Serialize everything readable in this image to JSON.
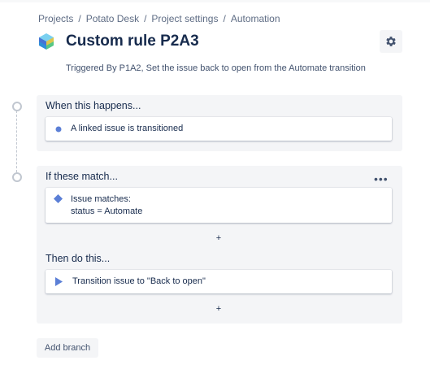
{
  "breadcrumb": {
    "items": [
      "Projects",
      "Potato Desk",
      "Project settings",
      "Automation"
    ],
    "separator": "/"
  },
  "rule": {
    "title": "Custom rule P2A3",
    "subtitle": "Triggered By P1A2, Set the issue back to open from the Automate transition"
  },
  "trigger": {
    "heading": "When this happens...",
    "card_text": "A linked issue is transitioned",
    "icon": "dot-icon"
  },
  "condition": {
    "heading": "If these match...",
    "more_label": "•••",
    "card_line1": "Issue matches:",
    "card_line2": "status = Automate",
    "icon": "diamond-icon",
    "add_label": "+"
  },
  "action": {
    "heading": "Then do this...",
    "card_text": "Transition issue to \"Back to open\"",
    "icon": "play-icon",
    "add_label": "+"
  },
  "add_branch_label": "Add branch",
  "colors": {
    "accent_blue": "#5b7fd6",
    "panel_bg": "#f4f5f7",
    "text_primary": "#172b4d",
    "text_secondary": "#5e6c84"
  }
}
